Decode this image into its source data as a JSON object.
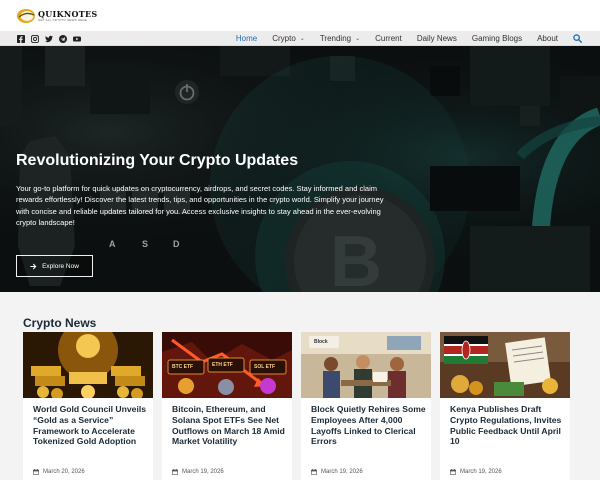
{
  "site": {
    "logo_name": "QUIKNOTES",
    "logo_tagline": "GET ALL CRYPTO NEWS HERE",
    "socials": [
      {
        "icon": "facebook-icon"
      },
      {
        "icon": "instagram-icon"
      },
      {
        "icon": "twitter-icon"
      },
      {
        "icon": "telegram-icon"
      },
      {
        "icon": "youtube-icon"
      }
    ]
  },
  "nav": {
    "items": [
      {
        "label": "Home",
        "active": true,
        "dropdown": false
      },
      {
        "label": "Crypto",
        "active": false,
        "dropdown": true
      },
      {
        "label": "Trending",
        "active": false,
        "dropdown": true
      },
      {
        "label": "Current",
        "active": false,
        "dropdown": false
      },
      {
        "label": "Daily News",
        "active": false,
        "dropdown": false
      },
      {
        "label": "Gaming Blogs",
        "active": false,
        "dropdown": false
      },
      {
        "label": "About",
        "active": false,
        "dropdown": false
      }
    ],
    "search_icon": "search-icon"
  },
  "hero": {
    "title": "Revolutionizing Your Crypto Updates",
    "description": "Your go-to platform for quick updates on cryptocurrency, airdrops, and secret codes. Stay informed and claim rewards effortlessly! Discover the latest trends, tips, and opportunities in the crypto world. Simplify your journey with concise and reliable updates tailored for you. Access exclusive insights to stay ahead in the ever-evolving crypto landscape!",
    "button_label": "Explore Now",
    "keys": [
      "A",
      "S",
      "D"
    ]
  },
  "news": {
    "heading": "Crypto News",
    "cards": [
      {
        "title": "World Gold Council Unveils “Gold as a Service” Framework to Accelerate Tokenized Gold Adoption",
        "date": "March 20, 2026"
      },
      {
        "title": "Bitcoin, Ethereum, and Solana Spot ETFs See Net Outflows on March 18 Amid Market Volatility",
        "date": "March 19, 2026",
        "img_labels": [
          "BTC ETF",
          "ETH ETF",
          "SOL ETF"
        ]
      },
      {
        "title": "Block Quietly Rehires Some Employees After 4,000 Layoffs Linked to Clerical Errors",
        "date": "March 19, 2026",
        "img_labels": [
          "Block"
        ]
      },
      {
        "title": "Kenya Publishes Draft Crypto Regulations, Invites Public Feedback Until April 10",
        "date": "March 19, 2026"
      }
    ]
  },
  "colors": {
    "accent": "#1d6fb8",
    "hero_teal": "#1f6e66",
    "heading": "#1a2a36",
    "navbar_bg": "#ececec",
    "news_bg": "#f3f3f3"
  }
}
